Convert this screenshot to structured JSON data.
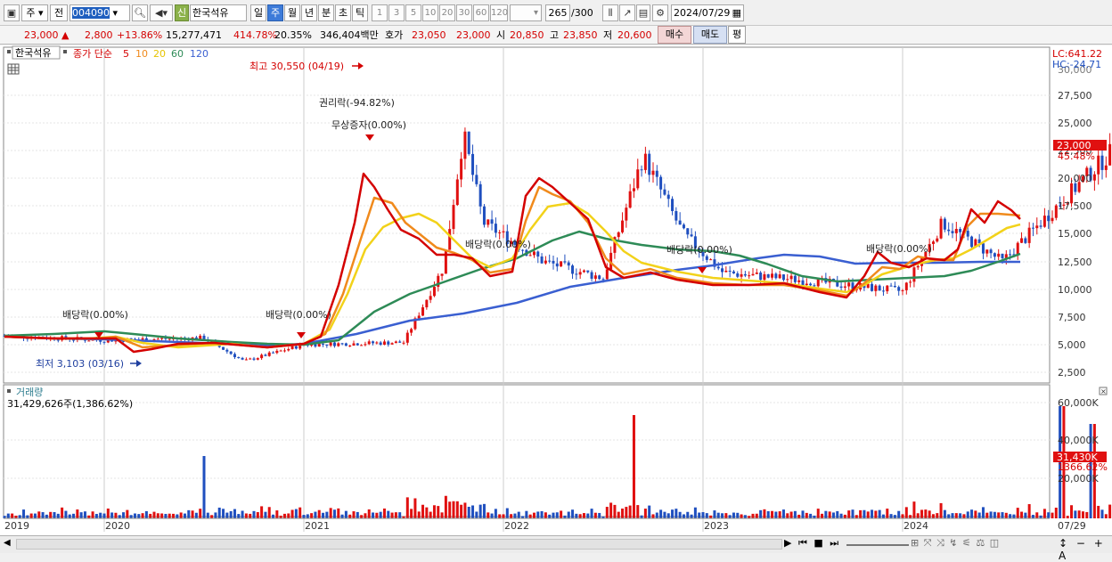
{
  "toolbar": {
    "stock_type": "주",
    "prev_label": "전",
    "code": "004090",
    "new_badge": "신",
    "stock_name": "한국석유",
    "periods": [
      "일",
      "주",
      "월",
      "년",
      "분",
      "초",
      "틱"
    ],
    "period_selected": "주",
    "intervals": [
      "1",
      "3",
      "5",
      "10",
      "20",
      "30",
      "60",
      "120"
    ],
    "count_display": "265",
    "count_total": "/300",
    "date": "2024/07/29"
  },
  "quote": {
    "price": "23,000",
    "change": "2,800",
    "change_pct": "+13.86%",
    "volume": "15,277,471",
    "volume_ratio": "414.78%",
    "turnover": "20.35%",
    "amount": "346,404백만",
    "hoga_label": "호가",
    "ask": "23,050",
    "bid": "23,000",
    "open_label": "시",
    "open": "20,850",
    "high_label": "고",
    "high": "23,850",
    "low_label": "저",
    "low": "20,600",
    "buy_button": "매수",
    "sell_button": "매도",
    "avg_button": "평"
  },
  "chart": {
    "stock_label": "한국석유",
    "legend_close": "종가 단순",
    "ma_periods": [
      "5",
      "10",
      "20",
      "60",
      "120"
    ],
    "ma_colors": [
      "#d40000",
      "#f08a1c",
      "#f2d21a",
      "#2e8b57",
      "#3a5fd1"
    ],
    "lc_label": "LC:641.22",
    "hc_label": "HC:-24.71",
    "price_tag": "23,000",
    "pct_tag": "45.48%",
    "high_annotation": "최고 30,550 (04/19)",
    "low_annotation": "최저 3,103 (03/16)",
    "rights_annotation": "권리락(-94.82%)",
    "bonus_annotation": "무상증자(0.00%)",
    "dividend_annotation": "배당락(0.00%)",
    "y_ticks": [
      "27,500",
      "25,000",
      "22,500",
      "20,000",
      "17,500",
      "15,000",
      "12,500",
      "10,000",
      "7,500",
      "5,000",
      "2,500"
    ],
    "volume_label": "거래량",
    "volume_info": "31,429,626주(1,386.62%)",
    "vol_ticks": [
      "60,000K",
      "40,000K",
      "20,000K"
    ],
    "vol_tag": "31,430K",
    "vol_pct_tag": "1366.62%",
    "x_labels": [
      "2019",
      "2020",
      "2021",
      "2022",
      "2023",
      "2024"
    ],
    "last_date": "07/29",
    "top_tick": "30,000"
  },
  "chart_data": {
    "type": "candlestick",
    "period": "weekly",
    "x": [
      "2019",
      "2020",
      "2021",
      "2022",
      "2023",
      "2024"
    ],
    "price_range": [
      2500,
      30000
    ],
    "close_series_estimate": [
      {
        "year": "2019.0",
        "close": 5800
      },
      {
        "year": "2019.5",
        "close": 5400
      },
      {
        "year": "2020.0",
        "close": 5600
      },
      {
        "year": "2020.2",
        "close": 3500
      },
      {
        "year": "2020.5",
        "close": 5000
      },
      {
        "year": "2021.0",
        "close": 5200
      },
      {
        "year": "2021.2",
        "close": 12000
      },
      {
        "year": "2021.3",
        "close": 24000
      },
      {
        "year": "2021.4",
        "close": 16000
      },
      {
        "year": "2021.7",
        "close": 12500
      },
      {
        "year": "2022.0",
        "close": 11000
      },
      {
        "year": "2022.2",
        "close": 22000
      },
      {
        "year": "2022.4",
        "close": 15000
      },
      {
        "year": "2022.6",
        "close": 11500
      },
      {
        "year": "2023.0",
        "close": 10800
      },
      {
        "year": "2023.5",
        "close": 9800
      },
      {
        "year": "2023.7",
        "close": 16000
      },
      {
        "year": "2024.0",
        "close": 12500
      },
      {
        "year": "2024.3",
        "close": 18000
      },
      {
        "year": "2024.58",
        "close": 23000
      }
    ],
    "volume_peaks_k": [
      {
        "year": "2020.0",
        "volume": 35000
      },
      {
        "year": "2022.15",
        "volume": 58000
      },
      {
        "year": "2024.3",
        "volume": 63000
      },
      {
        "year": "2024.45",
        "volume": 53000
      },
      {
        "year": "2024.58",
        "volume": 31430
      }
    ]
  }
}
